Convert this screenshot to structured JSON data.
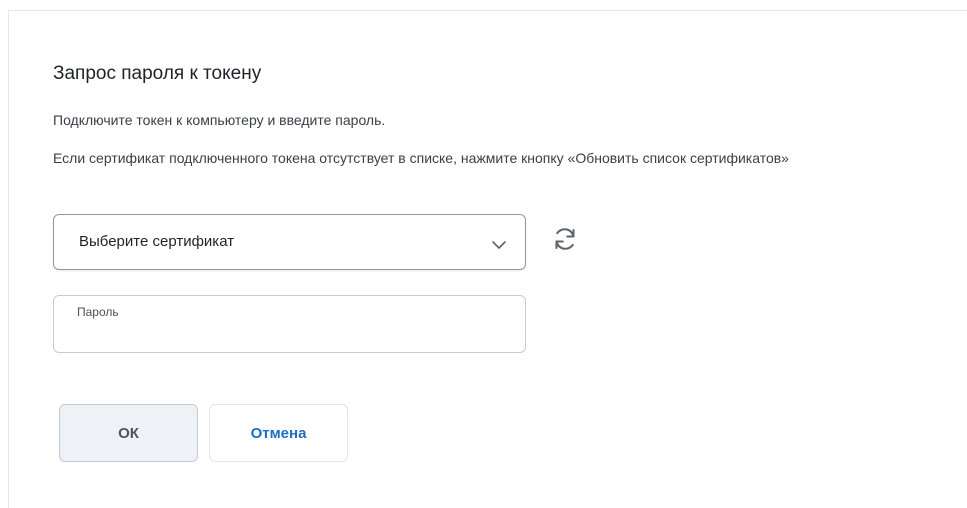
{
  "dialog": {
    "title": "Запрос пароля к токену",
    "hint_connect": "Подключите токен к компьютеру и введите пароль.",
    "hint_refresh": "Если сертификат подключенного токена отсутствует в списке, нажмите кнопку «Обновить список сертификатов»"
  },
  "certificate_select": {
    "selected_value": "Выберите сертификат",
    "icon": "chevron-down-icon"
  },
  "refresh_button": {
    "icon": "refresh-icon"
  },
  "password": {
    "label": "Пароль",
    "value": ""
  },
  "buttons": {
    "ok_label": "ОК",
    "cancel_label": "Отмена"
  },
  "colors": {
    "accent": "#1d6fc4",
    "ok_bg": "#eef2f6",
    "text": "#1f2329"
  }
}
